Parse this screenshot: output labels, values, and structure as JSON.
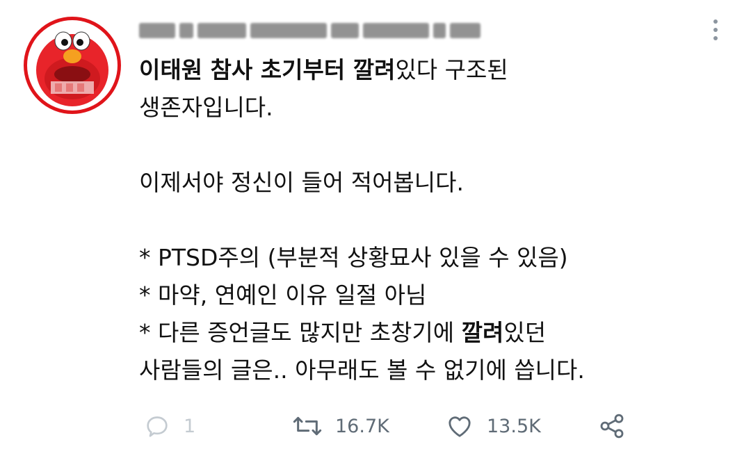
{
  "tweet": {
    "line1_bold": "이태원 참사 초기부터 깔려",
    "line1_rest": "있다 구조된",
    "line2": "생존자입니다.",
    "line3": "이제서야 정신이 들어 적어봅니다.",
    "line4": "* PTSD주의 (부분적 상황묘사 있을 수 있음)",
    "line5": "* 마약, 연예인 이유 일절 아님",
    "line6_pre": "* 다른 증언글도 많지만 초창기에 ",
    "line6_bold": "깔려",
    "line6_post": "있던",
    "line7": "사람들의 글은.. 아무래도 볼 수 없기에 씁니다."
  },
  "actions": {
    "reply_count": "1",
    "retweet_count": "16.7K",
    "like_count": "13.5K"
  },
  "icons": {
    "avatar": "elmo-avatar",
    "more": "more-vertical-icon",
    "reply": "reply-icon",
    "retweet": "retweet-icon",
    "like": "heart-icon",
    "share": "share-icon"
  },
  "colors": {
    "avatar_border": "#e0141a",
    "icon_gray": "#5f6b76",
    "reply_faded": "#c4cbd1"
  }
}
